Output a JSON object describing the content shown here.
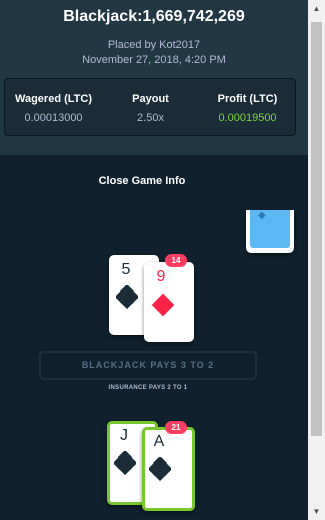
{
  "header": {
    "title": "Blackjack:1,669,742,269",
    "placed_by": "Placed by Kot2017",
    "date": "November 27, 2018, 4:20 PM"
  },
  "stats": {
    "wagered_label": "Wagered (LTC)",
    "wagered_value": "0.00013000",
    "payout_label": "Payout",
    "payout_value": "2.50x",
    "profit_label": "Profit (LTC)",
    "profit_value": "0.00019500"
  },
  "close_info": "Close Game Info",
  "dealer": {
    "score": "14",
    "cards": [
      {
        "rank": "5",
        "suit": "spade-icon",
        "color": "black"
      },
      {
        "rank": "9",
        "suit": "diamond-icon",
        "color": "red"
      }
    ]
  },
  "table_text": {
    "blackjack_pays": "BLACKJACK PAYS 3 TO 2",
    "insurance_pays": "INSURANCE PAYS 2 TO 1"
  },
  "player": {
    "score": "21",
    "cards": [
      {
        "rank": "J",
        "suit": "spade-icon",
        "color": "black"
      },
      {
        "rank": "A",
        "suit": "spade-icon",
        "color": "black"
      }
    ]
  },
  "colors": {
    "background": "#0f212e",
    "header_bg": "#213743",
    "profit": "#7fd63c",
    "badge": "#ff3d63",
    "win_border": "#76c82c",
    "red_suit": "#fe2247",
    "deck_back": "#5db7f3"
  }
}
